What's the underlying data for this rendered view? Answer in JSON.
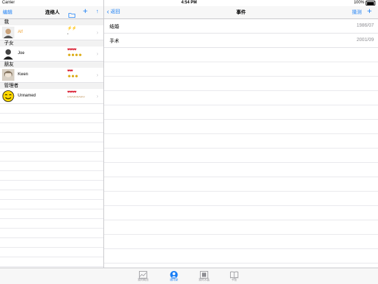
{
  "status_bar": {
    "carrier": "Carrier",
    "time": "4:54 PM",
    "battery": "100%"
  },
  "left": {
    "edit": "编辑",
    "title": "连络人",
    "sections": [
      {
        "header": "我",
        "rows": [
          {
            "name": "Alf",
            "name_color": "#f0a030",
            "rating1": "⚡⚡",
            "rating2": "-"
          }
        ]
      },
      {
        "header": "子女",
        "rows": [
          {
            "name": "Joe",
            "name_color": "#000000",
            "rating1": "♥♥♥♥♥",
            "rating2": "☻☻☻☻"
          }
        ]
      },
      {
        "header": "朋友",
        "rows": [
          {
            "name": "Kwen",
            "name_color": "#000000",
            "rating1": "♥♥♥",
            "rating2": "☻☻☻"
          }
        ]
      },
      {
        "header": "管理者",
        "rows": [
          {
            "name": "Unnamed",
            "name_color": "#000000",
            "rating1": "♥♥♥♥♥",
            "rating2": "〰〰〰〰〰"
          }
        ]
      }
    ]
  },
  "right": {
    "back": "返回",
    "title": "事件",
    "guess": "猜测",
    "events": [
      {
        "label": "结婚",
        "date": "1986/07"
      },
      {
        "label": "手术",
        "date": "2001/09"
      }
    ]
  },
  "tabs": [
    {
      "label": "我的概览",
      "icon": "chart-icon"
    },
    {
      "label": "通讯录",
      "icon": "person-icon"
    },
    {
      "label": "我的水晶",
      "icon": "photo-icon"
    },
    {
      "label": "书签",
      "icon": "book-icon"
    }
  ],
  "colors": {
    "accent": "#1a7ff5",
    "heart": "#d8162a",
    "smiley": "#d9a400"
  }
}
